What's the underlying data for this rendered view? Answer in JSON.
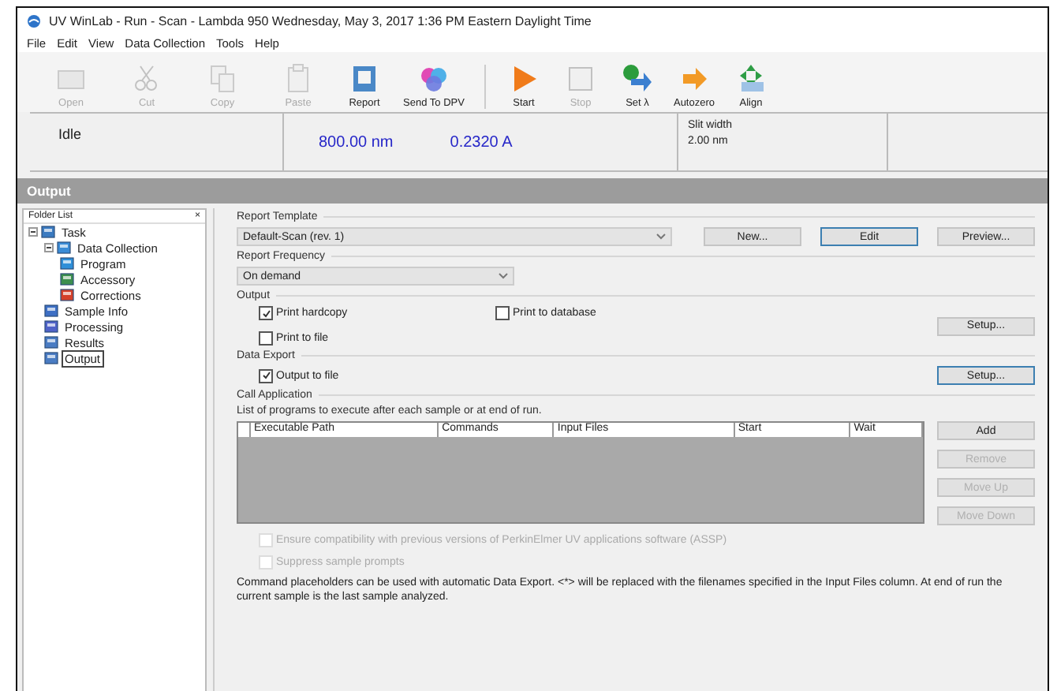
{
  "window": {
    "title": "UV WinLab - Run - Scan - Lambda 950 Wednesday, May 3, 2017 1:36 PM Eastern Daylight Time"
  },
  "menu": [
    "File",
    "Edit",
    "View",
    "Data Collection",
    "Tools",
    "Help"
  ],
  "toolbar": [
    {
      "label": "Open",
      "disabled": true
    },
    {
      "label": "Cut",
      "disabled": true
    },
    {
      "label": "Copy",
      "disabled": true
    },
    {
      "label": "Paste",
      "disabled": true
    },
    {
      "label": "Report",
      "disabled": false
    },
    {
      "label": "Send To DPV",
      "disabled": false
    },
    {
      "label": "Start",
      "disabled": false
    },
    {
      "label": "Stop",
      "disabled": true
    },
    {
      "label": "Set λ",
      "disabled": false
    },
    {
      "label": "Autozero",
      "disabled": false
    },
    {
      "label": "Align",
      "disabled": false
    }
  ],
  "status": {
    "state": "Idle",
    "wavelength": "800.00 nm",
    "absorbance": "0.2320 A",
    "slit_label": "Slit width",
    "slit_value": "2.00 nm"
  },
  "section_title": "Output",
  "folder_list": {
    "title": "Folder List",
    "close": "×",
    "tree": [
      {
        "label": "Task",
        "selected": false,
        "children": [
          {
            "label": "Data Collection",
            "selected": false,
            "children": [
              {
                "label": "Program",
                "selected": false
              },
              {
                "label": "Accessory",
                "selected": false
              },
              {
                "label": "Corrections",
                "selected": false
              }
            ]
          },
          {
            "label": "Sample Info",
            "selected": false
          },
          {
            "label": "Processing",
            "selected": false
          },
          {
            "label": "Results",
            "selected": false
          },
          {
            "label": "Output",
            "selected": true
          }
        ]
      }
    ]
  },
  "report_template": {
    "heading": "Report Template",
    "value": "Default-Scan (rev. 1)",
    "buttons": [
      {
        "label": "New...",
        "focused": false
      },
      {
        "label": "Edit",
        "focused": true
      },
      {
        "label": "Preview...",
        "focused": false
      }
    ]
  },
  "report_frequency": {
    "heading": "Report Frequency",
    "value": "On demand"
  },
  "output": {
    "heading": "Output",
    "options": [
      {
        "label": "Print hardcopy",
        "checked": true
      },
      {
        "label": "Print to database",
        "checked": false
      },
      {
        "label": "Print to file",
        "checked": false
      }
    ],
    "setup": "Setup..."
  },
  "data_export": {
    "heading": "Data Export",
    "options": [
      {
        "label": "Output to file",
        "checked": true
      }
    ],
    "setup": "Setup..."
  },
  "call_application": {
    "heading": "Call Application",
    "description": "List of programs to execute after each sample or at end of run.",
    "columns": [
      "Executable Path",
      "Commands",
      "Input Files",
      "Start",
      "Wait"
    ],
    "buttons": [
      {
        "label": "Add",
        "disabled": false
      },
      {
        "label": "Remove",
        "disabled": true
      },
      {
        "label": "Move Up",
        "disabled": true
      },
      {
        "label": "Move Down",
        "disabled": true
      }
    ],
    "options": [
      {
        "label": "Ensure compatibility with previous versions of PerkinElmer UV applications software (ASSP)",
        "checked": false,
        "disabled": true
      },
      {
        "label": "Suppress sample prompts",
        "checked": false,
        "disabled": true
      }
    ],
    "note": "Command placeholders can be used with automatic Data Export. <*> will be replaced with the filenames specified in the Input Files column. At end of run the current sample is the last sample analyzed."
  }
}
